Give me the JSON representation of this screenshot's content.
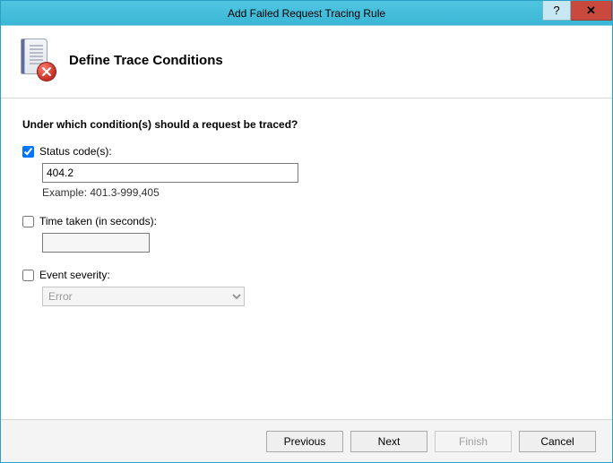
{
  "window": {
    "title": "Add Failed Request Tracing Rule"
  },
  "header": {
    "title": "Define Trace Conditions"
  },
  "content": {
    "question": "Under which condition(s) should a request be traced?",
    "statusCodes": {
      "label": "Status code(s):",
      "checked": true,
      "value": "404.2",
      "exampleLabel": "Example: 401.3-999,405"
    },
    "timeTaken": {
      "label": "Time taken (in seconds):",
      "checked": false,
      "value": ""
    },
    "eventSeverity": {
      "label": "Event severity:",
      "checked": false,
      "selected": "Error"
    }
  },
  "footer": {
    "previous": "Previous",
    "next": "Next",
    "finish": "Finish",
    "cancel": "Cancel"
  }
}
